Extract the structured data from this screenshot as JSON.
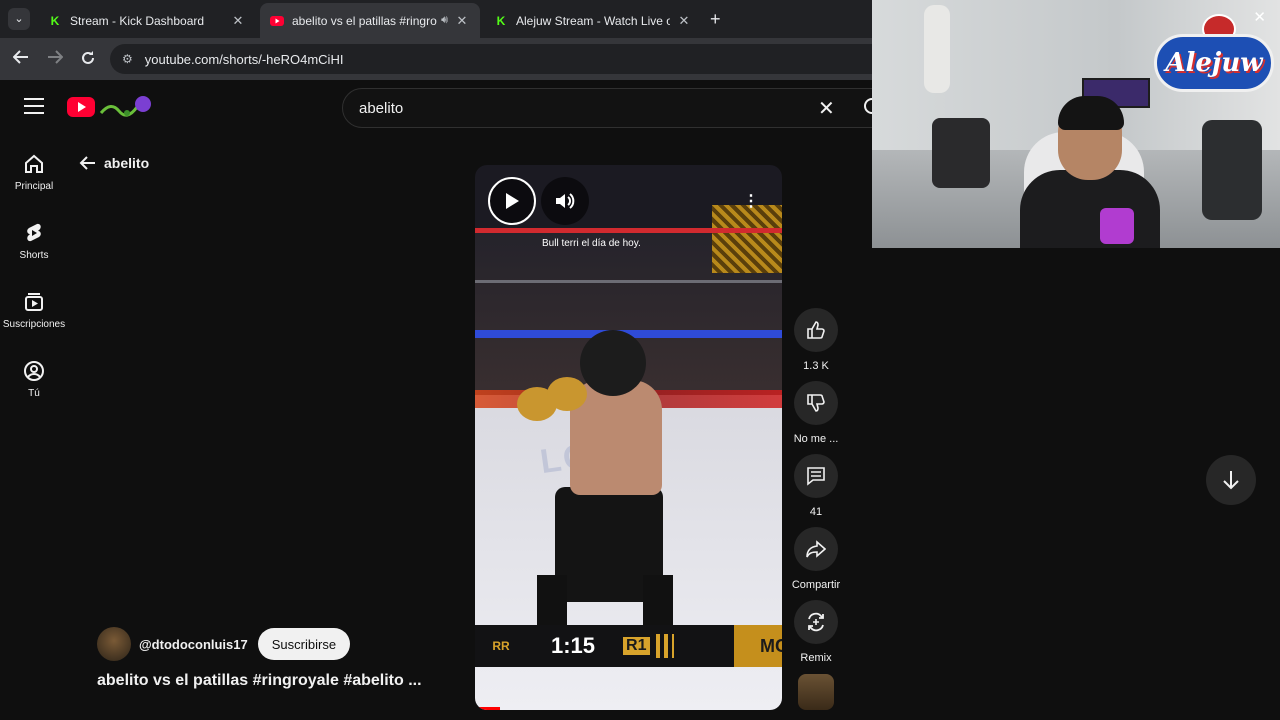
{
  "browser": {
    "tabs": [
      {
        "title": "Stream - Kick Dashboard",
        "favicon": "K",
        "favicon_color": "#53fc18"
      },
      {
        "title": "abelito vs el patillas #ringro",
        "favicon": "▶",
        "favicon_color": "#ff0033",
        "active": true
      },
      {
        "title": "Alejuw Stream - Watch Live on",
        "favicon": "K",
        "favicon_color": "#53fc18"
      }
    ],
    "url": "youtube.com/shorts/-heRO4mCiHI"
  },
  "youtube": {
    "search_query": "abelito",
    "back_label": "abelito",
    "guide": [
      {
        "label": "Principal",
        "icon": "home-icon"
      },
      {
        "label": "Shorts",
        "icon": "shorts-icon"
      },
      {
        "label": "Suscripciones",
        "icon": "subscriptions-icon"
      },
      {
        "label": "Tú",
        "icon": "account-icon"
      }
    ],
    "video": {
      "caption": "Bull terri el día de hoy.",
      "score_time": "1:15",
      "score_round": "R1",
      "score_tag": "MC",
      "score_logo": "RR",
      "canvas_text": "LOLILI",
      "progress": 0.08
    },
    "actions": {
      "like_count": "1.3 K",
      "dislike_label": "No me ...",
      "comment_count": "41",
      "share_label": "Compartir",
      "remix_label": "Remix"
    },
    "channel": {
      "handle": "@dtodoconluis17",
      "subscribe_label": "Suscribirse"
    },
    "title": "abelito vs el patillas #ringroyale #abelito ..."
  },
  "webcam": {
    "logo_text": "Alejuw"
  },
  "colors": {
    "accent_red": "#ff0033",
    "kick_green": "#53fc18",
    "bg": "#0f0f0f"
  }
}
